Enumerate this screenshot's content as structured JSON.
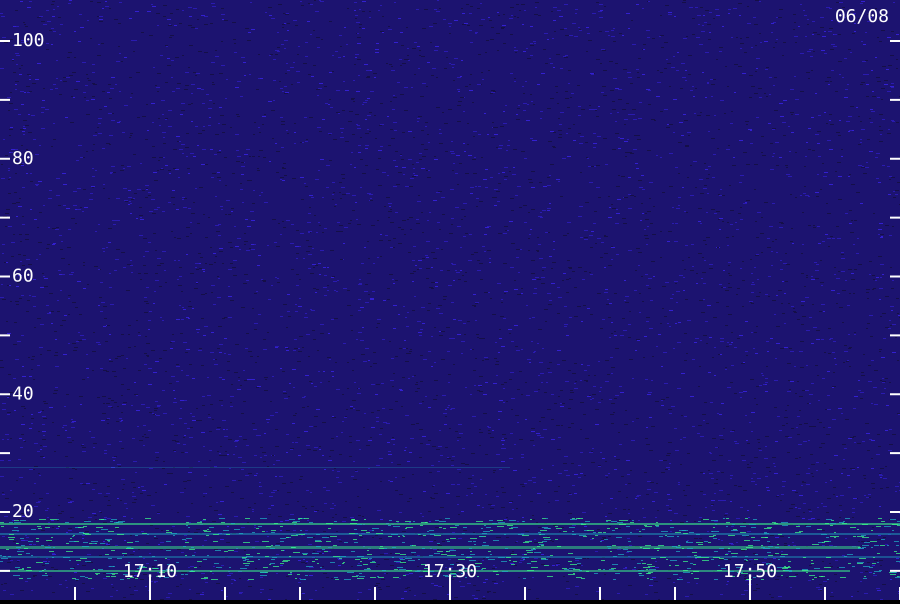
{
  "chart_data": {
    "type": "heatmap",
    "date_label": "06/08",
    "y_ticks": [
      20,
      40,
      60,
      80,
      100
    ],
    "y_minor_ticks": [
      10,
      30,
      50,
      70,
      90
    ],
    "x_tick_labels": [
      "17:10",
      "17:30",
      "17:50"
    ],
    "x_minor_tick_labels": [
      "17:05",
      "17:15",
      "17:20",
      "17:25",
      "17:35",
      "17:40",
      "17:45",
      "17:55",
      "18:00"
    ],
    "ylim": [
      7,
      105
    ],
    "x_start": "17:05",
    "x_end": "18:00",
    "colors": {
      "noise_deep": "#150f48",
      "noise_mid": "#2a1bb0",
      "noise_bright": "#3320d0",
      "signal_low": "#1fb0c8",
      "signal_high": "#3dff8c"
    }
  }
}
